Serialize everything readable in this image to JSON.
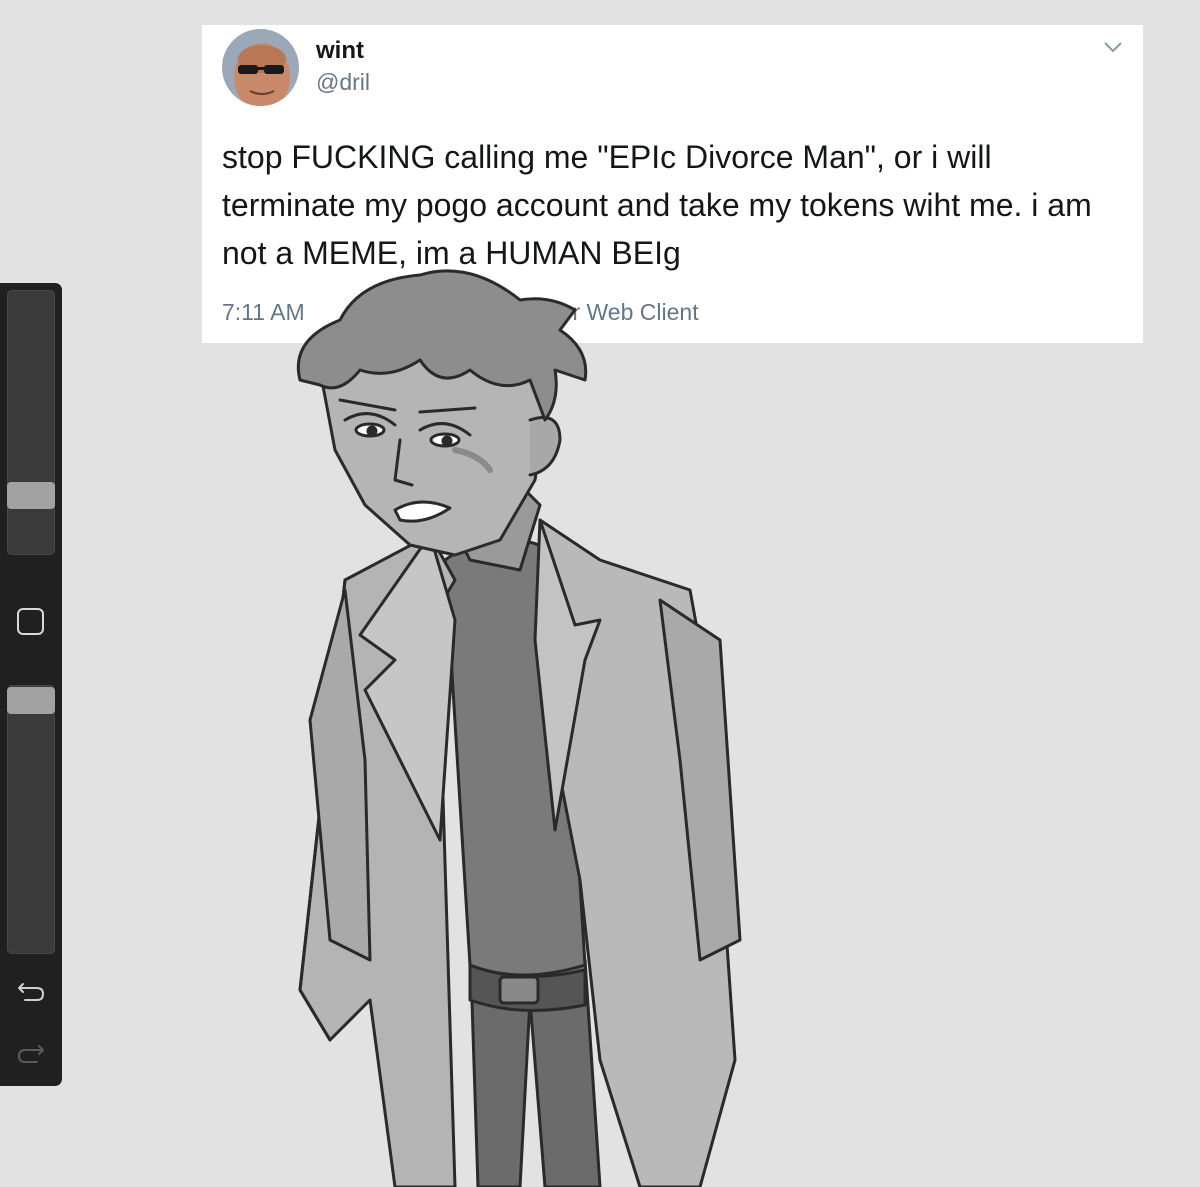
{
  "tweet": {
    "display_name": "wint",
    "handle": "@dril",
    "text": "stop FUCKING calling me \"EPIc Divorce Man\", or i will terminate my pogo account and take my tokens wiht me. i am not a MEME, im a HUMAN BEIg",
    "meta_visible": "7:11 AM",
    "meta_source_fragment": "r Web Client",
    "avatar_icon": "avatar-image",
    "menu_icon": "chevron-down-icon"
  },
  "sidebar": {
    "brush_size_level": 0.78,
    "brush_opacity_level": 1.0,
    "modify_icon": "square-icon",
    "undo_icon": "undo-arrow-icon",
    "redo_icon": "redo-arrow-icon"
  },
  "colors": {
    "canvas": "#e2e2e2",
    "toolbar": "#202020",
    "tweet_text": "#14171a",
    "tweet_meta": "#657786"
  }
}
